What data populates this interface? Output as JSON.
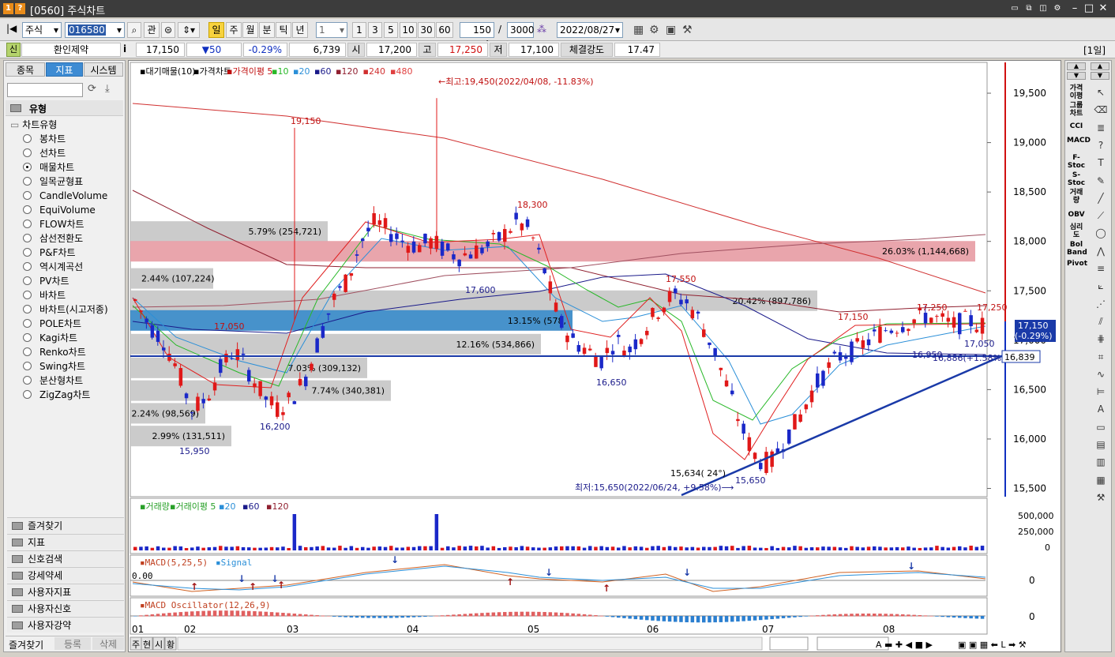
{
  "window": {
    "title": "[0560] 주식차트",
    "badges": [
      "1",
      "?"
    ]
  },
  "toolbar": {
    "market": "주식",
    "code": "016580",
    "btn_gwan": "관",
    "periods": [
      "일",
      "주",
      "월",
      "분",
      "틱",
      "년"
    ],
    "interval": "1",
    "quick": [
      "1",
      "3",
      "5",
      "10",
      "30",
      "60"
    ],
    "count": "150",
    "total": "3000",
    "date": "2022/08/27"
  },
  "quote": {
    "tag": "신",
    "name": "환인제약",
    "info": "i",
    "price": "17,150",
    "change": "▼50",
    "pct": "-0.29%",
    "volume": "6,739",
    "open_label": "시",
    "open": "17,200",
    "high_label": "고",
    "high": "17,250",
    "low_label": "저",
    "low": "17,100",
    "strength_label": "체결강도",
    "strength": "17.47",
    "period_badge": "[1일]"
  },
  "left": {
    "tabs": [
      "종목",
      "지표",
      "시스템"
    ],
    "section": "유형",
    "subsection": "차트유형",
    "types": [
      "봉차트",
      "선차트",
      "매물차트",
      "일목균형표",
      "CandleVolume",
      "EquiVolume",
      "FLOW차트",
      "삼선전환도",
      "P&F차트",
      "역시계곡선",
      "PV차트",
      "바차트",
      "바차트(시고저종)",
      "POLE차트",
      "Kagi차트",
      "Renko차트",
      "Swing차트",
      "분산형차트",
      "ZigZag차트"
    ],
    "selected": 2,
    "folders": [
      "즐겨찾기",
      "지표",
      "신호검색",
      "강세약세",
      "사용자지표",
      "사용자신호",
      "사용자강약"
    ],
    "bottom_tabs": [
      "즐겨찾기",
      "등록",
      "삭제"
    ]
  },
  "legend": {
    "main": [
      "대기매물(10)",
      "가격차트",
      "가격이평 5",
      "10",
      "20",
      "60",
      "120",
      "240",
      "480"
    ],
    "volume": [
      "거래량",
      "거래이평 5",
      "20",
      "60",
      "120"
    ],
    "macd": [
      "MACD(5,25,5)",
      "Signal"
    ],
    "osc": [
      "MACD Oscillator(12,26,9)"
    ]
  },
  "chart_data": {
    "type": "candlestick",
    "price_axis": [
      "19,500",
      "19,000",
      "18,500",
      "18,000",
      "17,500",
      "17,000",
      "16,500",
      "16,000",
      "15,500"
    ],
    "volume_axis": [
      "500,000",
      "250,000",
      "0"
    ],
    "macd_axis": [
      "0"
    ],
    "osc_axis": [
      "0"
    ],
    "macd_zero": "0.00",
    "months": [
      "01",
      "02",
      "03",
      "04",
      "05",
      "06",
      "07",
      "08"
    ],
    "annotations": [
      "←최고:19,450(2022/04/08, -11.83%)",
      "최저:15,650(2022/06/24, +9.58%)⟶",
      "19,150",
      "18,300",
      "17,550",
      "17,050",
      "16,200",
      "15,950",
      "17,600",
      "16,650",
      "15,634( 24°)",
      "15,650",
      "17,150",
      "17,250",
      "17,250",
      "17,050",
      "16,950",
      "16,886(+1.58%)"
    ],
    "volume_profile": [
      {
        "label": "5.79% (254,721)",
        "price": 18100
      },
      {
        "label": "26.03% (1,144,668)",
        "price": 17900
      },
      {
        "label": "2.44% (107,224)",
        "price": 17625
      },
      {
        "label": "20.42% (897,786)",
        "price": 17400
      },
      {
        "label": "13.15% (578,",
        "price": 17200
      },
      {
        "label": "12.16% (534,866)",
        "price": 16960
      },
      {
        "label": "7.03% (309,132)",
        "price": 16720
      },
      {
        "label": "7.74% (340,381)",
        "price": 16490
      },
      {
        "label": "2.24% (98,569)",
        "price": 16260
      },
      {
        "label": "2.99% (131,511)",
        "price": 16030
      }
    ],
    "current": {
      "price": "17,150",
      "pct": "(-0.29%)",
      "trend": "16,839"
    }
  },
  "bottom": {
    "tabs": [
      "주",
      "현",
      "시",
      "황"
    ]
  },
  "right": {
    "indicators": [
      "가격이평",
      "그룹차트",
      "CCI",
      "MACD",
      "F-Stoc",
      "S-Stoc",
      "거래량",
      "OBV",
      "심리도",
      "Bol Band",
      "Pivot"
    ]
  }
}
